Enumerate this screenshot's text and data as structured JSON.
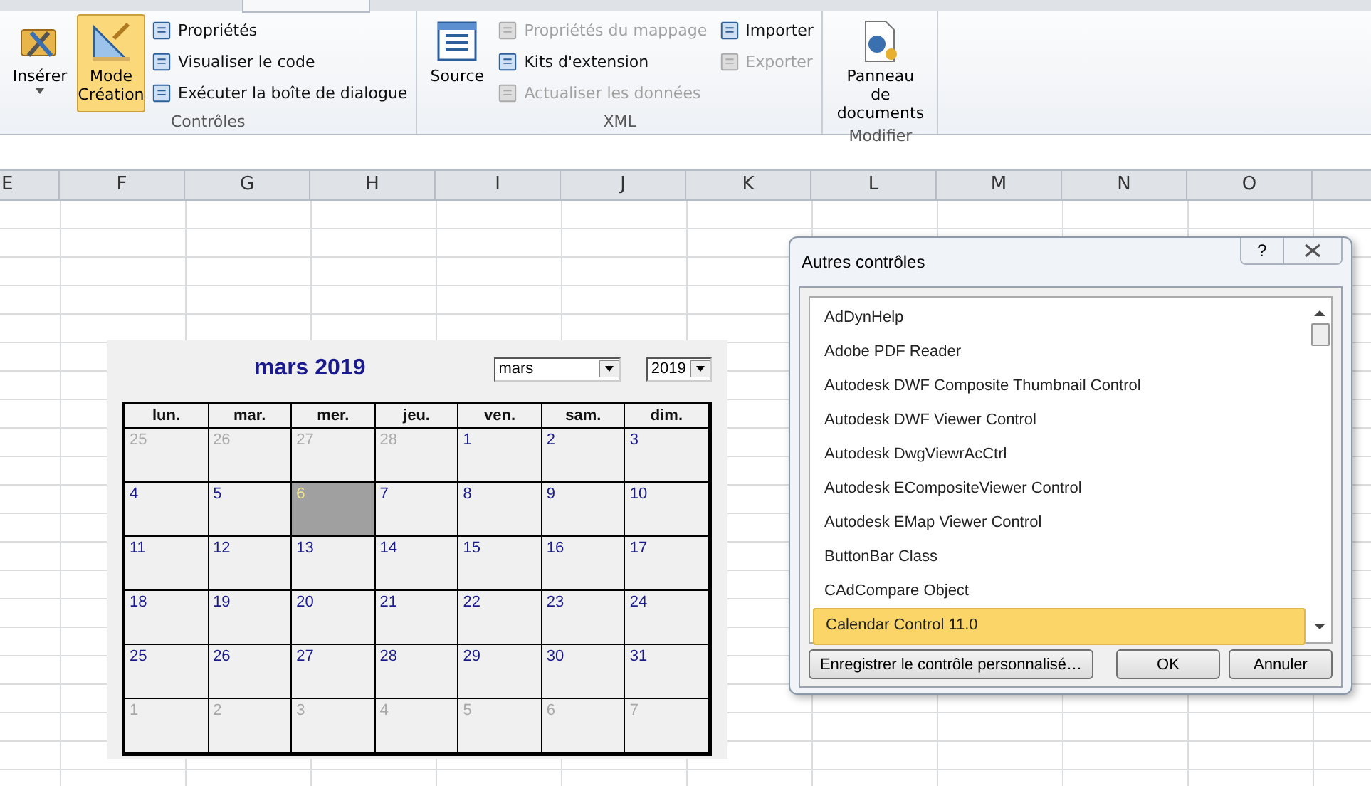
{
  "ribbon": {
    "groups": [
      {
        "label": "Contrôles",
        "large": [
          {
            "label": "Insérer",
            "selected": false,
            "dropdown": true
          },
          {
            "label": "Mode Création",
            "selected": true,
            "dropdown": false
          }
        ],
        "small": [
          {
            "label": "Propriétés",
            "disabled": false
          },
          {
            "label": "Visualiser le code",
            "disabled": false
          },
          {
            "label": "Exécuter la boîte de dialogue",
            "disabled": false
          }
        ]
      },
      {
        "label": "XML",
        "large": [
          {
            "label": "Source",
            "selected": false,
            "dropdown": false
          }
        ],
        "small": [
          {
            "label": "Propriétés du mappage",
            "disabled": true
          },
          {
            "label": "Kits d'extension",
            "disabled": false
          },
          {
            "label": "Actualiser les données",
            "disabled": true
          },
          {
            "label": "Importer",
            "disabled": false
          },
          {
            "label": "Exporter",
            "disabled": true
          }
        ]
      },
      {
        "label": "Modifier",
        "large": [
          {
            "label": "Panneau de documents",
            "selected": false,
            "dropdown": false
          }
        ]
      }
    ]
  },
  "columns": [
    "E",
    "F",
    "G",
    "H",
    "I",
    "J",
    "K",
    "L",
    "M",
    "N",
    "O"
  ],
  "calendar": {
    "title": "mars 2019",
    "month": "mars",
    "year": "2019",
    "weekdays": [
      "lun.",
      "mar.",
      "mer.",
      "jeu.",
      "ven.",
      "sam.",
      "dim."
    ],
    "weeks": [
      [
        {
          "label": "25",
          "muted": true,
          "selected": false
        },
        {
          "label": "26",
          "muted": true,
          "selected": false
        },
        {
          "label": "27",
          "muted": true,
          "selected": false
        },
        {
          "label": "28",
          "muted": true,
          "selected": false
        },
        {
          "label": "1",
          "muted": false,
          "selected": false
        },
        {
          "label": "2",
          "muted": false,
          "selected": false
        },
        {
          "label": "3",
          "muted": false,
          "selected": false
        }
      ],
      [
        {
          "label": "4",
          "muted": false,
          "selected": false
        },
        {
          "label": "5",
          "muted": false,
          "selected": false
        },
        {
          "label": "6",
          "muted": false,
          "selected": true
        },
        {
          "label": "7",
          "muted": false,
          "selected": false
        },
        {
          "label": "8",
          "muted": false,
          "selected": false
        },
        {
          "label": "9",
          "muted": false,
          "selected": false
        },
        {
          "label": "10",
          "muted": false,
          "selected": false
        }
      ],
      [
        {
          "label": "11",
          "muted": false,
          "selected": false
        },
        {
          "label": "12",
          "muted": false,
          "selected": false
        },
        {
          "label": "13",
          "muted": false,
          "selected": false
        },
        {
          "label": "14",
          "muted": false,
          "selected": false
        },
        {
          "label": "15",
          "muted": false,
          "selected": false
        },
        {
          "label": "16",
          "muted": false,
          "selected": false
        },
        {
          "label": "17",
          "muted": false,
          "selected": false
        }
      ],
      [
        {
          "label": "18",
          "muted": false,
          "selected": false
        },
        {
          "label": "19",
          "muted": false,
          "selected": false
        },
        {
          "label": "20",
          "muted": false,
          "selected": false
        },
        {
          "label": "21",
          "muted": false,
          "selected": false
        },
        {
          "label": "22",
          "muted": false,
          "selected": false
        },
        {
          "label": "23",
          "muted": false,
          "selected": false
        },
        {
          "label": "24",
          "muted": false,
          "selected": false
        }
      ],
      [
        {
          "label": "25",
          "muted": false,
          "selected": false
        },
        {
          "label": "26",
          "muted": false,
          "selected": false
        },
        {
          "label": "27",
          "muted": false,
          "selected": false
        },
        {
          "label": "28",
          "muted": false,
          "selected": false
        },
        {
          "label": "29",
          "muted": false,
          "selected": false
        },
        {
          "label": "30",
          "muted": false,
          "selected": false
        },
        {
          "label": "31",
          "muted": false,
          "selected": false
        }
      ],
      [
        {
          "label": "1",
          "muted": true,
          "selected": false
        },
        {
          "label": "2",
          "muted": true,
          "selected": false
        },
        {
          "label": "3",
          "muted": true,
          "selected": false
        },
        {
          "label": "4",
          "muted": true,
          "selected": false
        },
        {
          "label": "5",
          "muted": true,
          "selected": false
        },
        {
          "label": "6",
          "muted": true,
          "selected": false
        },
        {
          "label": "7",
          "muted": true,
          "selected": false
        }
      ]
    ]
  },
  "dialog": {
    "title": "Autres contrôles",
    "help": "?",
    "items": [
      {
        "label": "AdDynHelp",
        "selected": false
      },
      {
        "label": "Adobe PDF Reader",
        "selected": false
      },
      {
        "label": "Autodesk DWF Composite Thumbnail Control",
        "selected": false
      },
      {
        "label": "Autodesk DWF Viewer Control",
        "selected": false
      },
      {
        "label": "Autodesk DwgViewrAcCtrl",
        "selected": false
      },
      {
        "label": "Autodesk ECompositeViewer Control",
        "selected": false
      },
      {
        "label": "Autodesk EMap Viewer Control",
        "selected": false
      },
      {
        "label": "ButtonBar Class",
        "selected": false
      },
      {
        "label": "CAdCompare Object",
        "selected": false
      },
      {
        "label": "Calendar Control 11.0",
        "selected": true
      }
    ],
    "buttons": [
      "Enregistrer le contrôle personnalisé…",
      "OK",
      "Annuler"
    ]
  }
}
